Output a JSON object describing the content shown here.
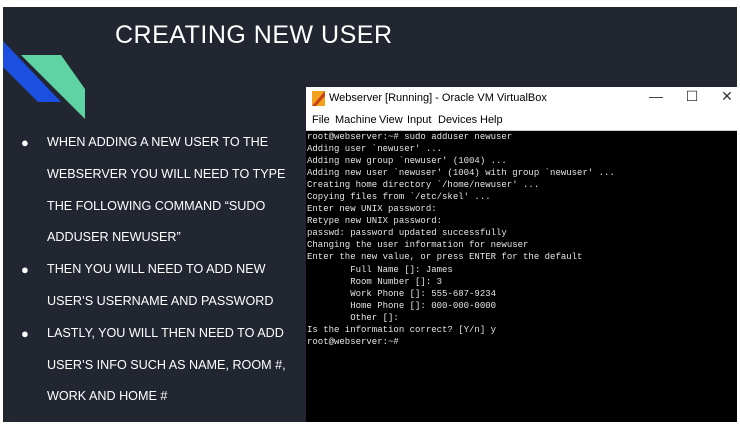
{
  "slide": {
    "title": "CREATING NEW USER",
    "colors": {
      "background": "#212631",
      "accent_blue": "#1b4fe0",
      "accent_green": "#5fd3a3"
    },
    "bullets": [
      {
        "lines": [
          "WHEN ADDING A NEW USER TO THE",
          "WEBSERVER YOU WILL NEED TO TYPE",
          "THE FOLLOWING COMMAND “SUDO",
          "ADDUSER NEWUSER”"
        ]
      },
      {
        "lines": [
          "THEN YOU WILL NEED TO ADD NEW",
          "USER’S USERNAME AND PASSWORD"
        ]
      },
      {
        "lines": [
          "LASTLY, YOU WILL THEN NEED TO ADD",
          "USER’S INFO SUCH AS NAME, ROOM #,",
          "WORK AND HOME #"
        ]
      }
    ]
  },
  "window": {
    "title": "Webserver [Running] - Oracle VM VirtualBox",
    "controls": {
      "minimize": "—",
      "maximize": "☐",
      "close": "✕"
    },
    "menu": [
      "File",
      "Machine",
      "View",
      "Input",
      "Devices",
      "Help"
    ],
    "terminal_lines": [
      "root@webserver:~# sudo adduser newuser",
      "Adding user `newuser' ...",
      "Adding new group `newuser' (1004) ...",
      "Adding new user `newuser' (1004) with group `newuser' ...",
      "Creating home directory `/home/newuser' ...",
      "Copying files from `/etc/skel' ...",
      "Enter new UNIX password:",
      "Retype new UNIX password:",
      "passwd: password updated successfully",
      "Changing the user information for newuser",
      "Enter the new value, or press ENTER for the default",
      "        Full Name []: James",
      "        Room Number []: 3",
      "        Work Phone []: 555-687-9234",
      "        Home Phone []: 000-000-0000",
      "        Other []:",
      "Is the information correct? [Y/n] y",
      "root@webserver:~#"
    ]
  }
}
